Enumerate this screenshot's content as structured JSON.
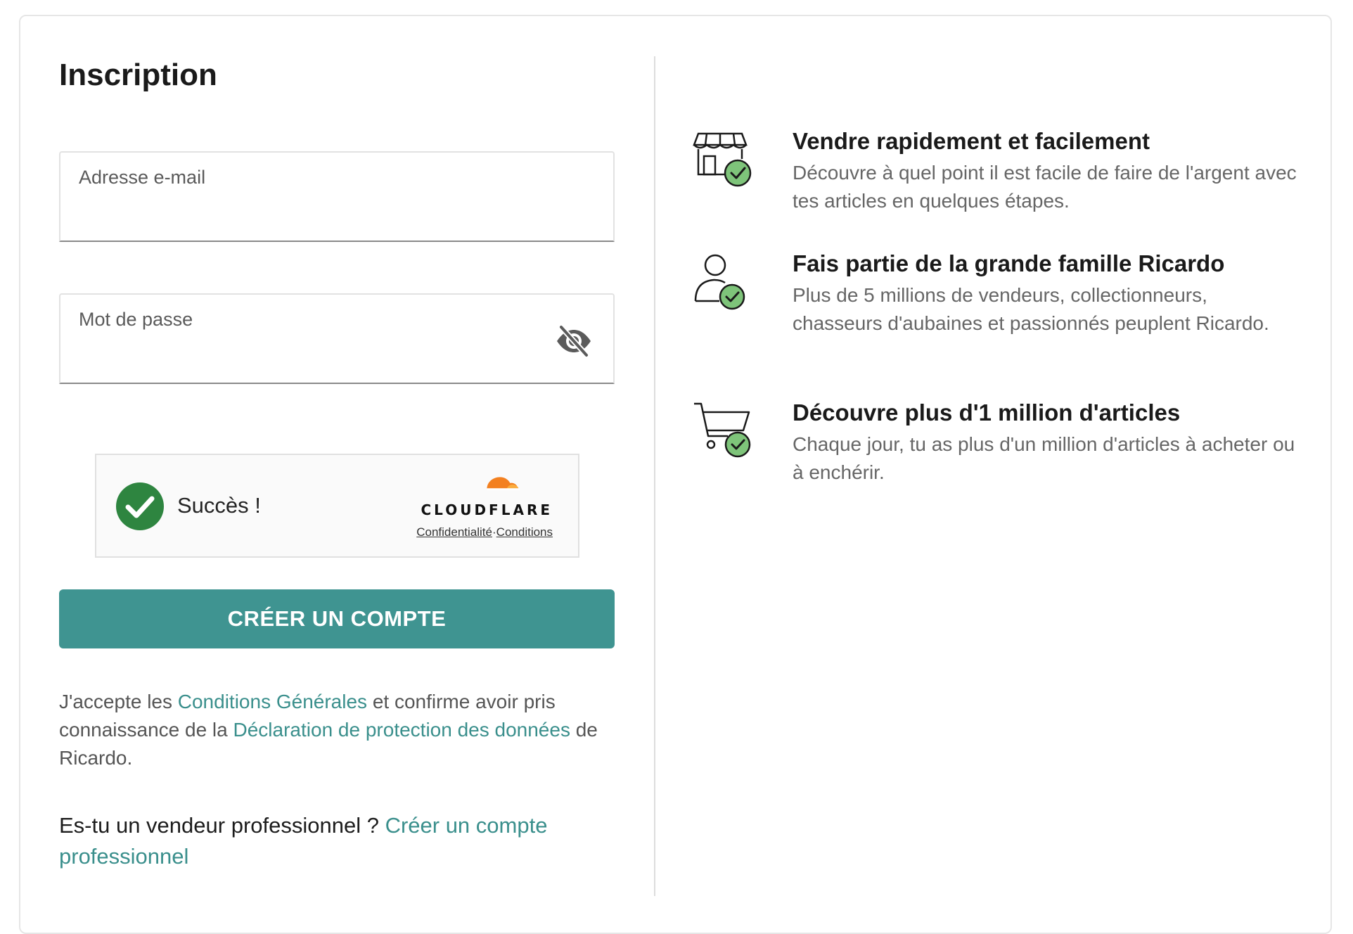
{
  "form": {
    "title": "Inscription",
    "email_label": "Adresse e-mail",
    "email_value": "",
    "password_label": "Mot de passe",
    "password_value": "",
    "password_toggle_icon": "eye-slash-icon"
  },
  "captcha": {
    "status_text": "Succès !",
    "status_icon": "check-circle-icon",
    "brand": "CLOUDFLARE",
    "privacy_link": "Confidentialité",
    "separator": "·",
    "terms_link": "Conditions"
  },
  "submit_label": "CRÉER UN COMPTE",
  "legal": {
    "prefix": "J'accepte les ",
    "terms_link": "Conditions Générales",
    "middle": " et confirme avoir pris connaissance de la ",
    "privacy_link": "Déclaration de protection des données",
    "suffix": " de Ricardo."
  },
  "professional": {
    "question": "Es-tu un vendeur professionnel ? ",
    "link": "Créer un compte professionnel"
  },
  "benefits": [
    {
      "icon": "storefront-check-icon",
      "title": "Vendre rapidement et facilement",
      "description": "Découvre à quel point il est facile de faire de l'argent avec tes articles en quelques étapes."
    },
    {
      "icon": "person-check-icon",
      "title": "Fais partie de la grande famille Ricardo",
      "description": "Plus de 5 millions de vendeurs, collectionneurs, chasseurs d'aubaines et passionnés peuplent Ricardo."
    },
    {
      "icon": "cart-check-icon",
      "title": "Découvre plus d'1 million d'articles",
      "description": "Chaque jour, tu as plus d'un million d'articles à acheter ou à enchérir."
    }
  ],
  "colors": {
    "accent": "#3f9491",
    "link": "#3a8f8c",
    "success": "#2e8540",
    "cloudflare_orange": "#f38020",
    "check_badge": "#7ec47a"
  }
}
